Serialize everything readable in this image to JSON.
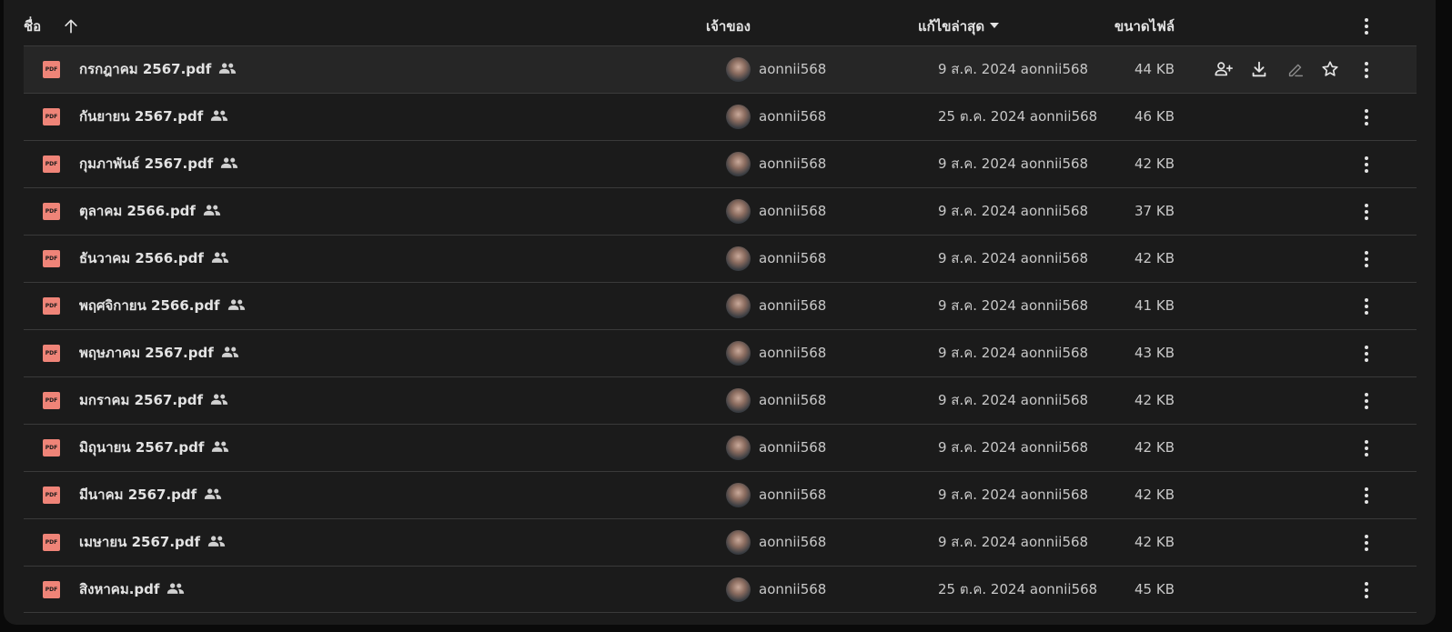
{
  "header": {
    "name_label": "ชื่อ",
    "owner_label": "เจ้าของ",
    "modified_label": "แก้ไขล่าสุด",
    "size_label": "ขนาดไฟล์",
    "sort_icon": "arrow-up-icon",
    "more_icon": "more-vert-icon"
  },
  "colors": {
    "background": "#1b1b1b",
    "hover_row": "#262626",
    "divider": "#3a3a3a",
    "pdf_icon": "#ef8478",
    "text": "#e3e3e3"
  },
  "hover_actions": [
    "share-person-add-icon",
    "download-icon",
    "rename-edit-icon",
    "star-icon"
  ],
  "files": [
    {
      "name": "กรกฎาคม 2567.pdf",
      "owner": "aonnii568",
      "modified": "9 ส.ค. 2024  aonnii568",
      "size": "44 KB",
      "hovered": true
    },
    {
      "name": "กันยายน 2567.pdf",
      "owner": "aonnii568",
      "modified": "25 ต.ค. 2024  aonnii568",
      "size": "46 KB"
    },
    {
      "name": "กุมภาพันธ์ 2567.pdf",
      "owner": "aonnii568",
      "modified": "9 ส.ค. 2024  aonnii568",
      "size": "42 KB"
    },
    {
      "name": "ตุลาคม 2566.pdf",
      "owner": "aonnii568",
      "modified": "9 ส.ค. 2024  aonnii568",
      "size": "37 KB"
    },
    {
      "name": "ธันวาคม 2566.pdf",
      "owner": "aonnii568",
      "modified": "9 ส.ค. 2024  aonnii568",
      "size": "42 KB"
    },
    {
      "name": "พฤศจิกายน 2566.pdf",
      "owner": "aonnii568",
      "modified": "9 ส.ค. 2024  aonnii568",
      "size": "41 KB"
    },
    {
      "name": "พฤษภาคม 2567.pdf",
      "owner": "aonnii568",
      "modified": "9 ส.ค. 2024  aonnii568",
      "size": "43 KB"
    },
    {
      "name": "มกราคม 2567.pdf",
      "owner": "aonnii568",
      "modified": "9 ส.ค. 2024  aonnii568",
      "size": "42 KB"
    },
    {
      "name": "มิถุนายน 2567.pdf",
      "owner": "aonnii568",
      "modified": "9 ส.ค. 2024  aonnii568",
      "size": "42 KB"
    },
    {
      "name": "มีนาคม 2567.pdf",
      "owner": "aonnii568",
      "modified": "9 ส.ค. 2024  aonnii568",
      "size": "42 KB"
    },
    {
      "name": "เมษายน 2567.pdf",
      "owner": "aonnii568",
      "modified": "9 ส.ค. 2024  aonnii568",
      "size": "42 KB"
    },
    {
      "name": "สิงหาคม.pdf",
      "owner": "aonnii568",
      "modified": "25 ต.ค. 2024  aonnii568",
      "size": "45 KB"
    }
  ]
}
